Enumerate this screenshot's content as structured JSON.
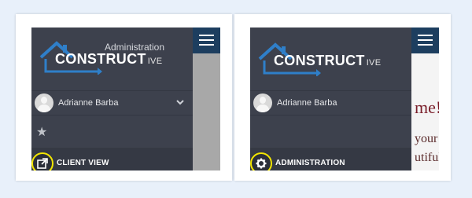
{
  "panels": [
    {
      "admin_label": "Administration",
      "logo_main": "CONSTRUCT",
      "logo_suffix": "IVE",
      "user_name": "Adrianne Barba",
      "action_label": "CLIENT VIEW",
      "action_icon": "external-link-icon"
    },
    {
      "logo_main": "CONSTRUCT",
      "logo_suffix": "IVE",
      "user_name": "Adrianne Barba",
      "action_label": "ADMINISTRATION",
      "action_icon": "gear-icon",
      "content_fragments": [
        "me!",
        "your",
        "utiful"
      ]
    }
  ],
  "colors": {
    "sidebar": "#3d414d",
    "topbar": "#1d3e5f",
    "highlight_ring": "#f2e500",
    "logo_house": "#2f7fc9"
  }
}
